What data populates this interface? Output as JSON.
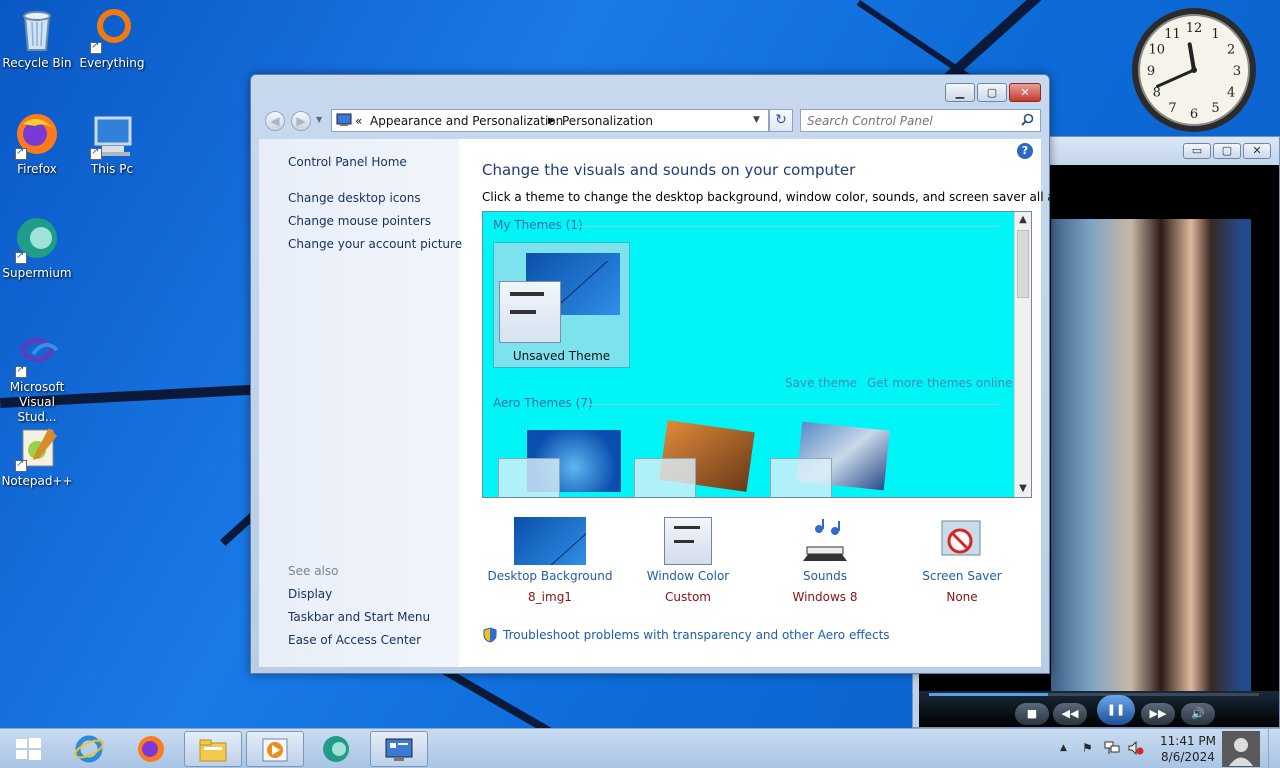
{
  "desktop": {
    "icons": [
      {
        "label": "Recycle Bin",
        "icon": "recycle-bin-icon"
      },
      {
        "label": "Everything",
        "icon": "everything-icon"
      },
      {
        "label": "Firefox",
        "icon": "firefox-icon"
      },
      {
        "label": "This Pc",
        "icon": "computer-icon"
      },
      {
        "label": "Supermium",
        "icon": "supermium-icon"
      },
      {
        "label": "Microsoft Visual Stud...",
        "icon": "visual-studio-icon"
      },
      {
        "label": "Notepad++",
        "icon": "notepad-plus-icon"
      }
    ]
  },
  "clock": {
    "time_shown": "11:41",
    "numerals": [
      "12",
      "1",
      "2",
      "3",
      "4",
      "5",
      "6",
      "7",
      "8",
      "9",
      "10",
      "11"
    ]
  },
  "window": {
    "address": {
      "crumb_root": "«",
      "crumb1": "Appearance and Personalization",
      "crumb2": "Personalization"
    },
    "search_placeholder": "Search Control Panel",
    "left_nav": {
      "home": "Control Panel Home",
      "links": [
        "Change desktop icons",
        "Change mouse pointers",
        "Change your account picture"
      ],
      "see_also_header": "See also",
      "see_also": [
        "Display",
        "Taskbar and Start Menu",
        "Ease of Access Center"
      ]
    },
    "main": {
      "title": "Change the visuals and sounds on your computer",
      "subtitle": "Click a theme to change the desktop background, window color, sounds, and screen saver all at once.",
      "my_themes_header": "My Themes (1)",
      "unsaved_theme_label": "Unsaved Theme",
      "save_theme_link": "Save theme",
      "get_more_link": "Get more themes online",
      "aero_themes_header": "Aero Themes (7)",
      "bottom_items": [
        {
          "name": "Desktop Background",
          "value": "8_img1",
          "icon": "desktop-background-icon"
        },
        {
          "name": "Window Color",
          "value": "Custom",
          "icon": "window-color-icon"
        },
        {
          "name": "Sounds",
          "value": "Windows 8",
          "icon": "sounds-icon"
        },
        {
          "name": "Screen Saver",
          "value": "None",
          "icon": "screen-saver-icon"
        }
      ],
      "troubleshoot_link": "Troubleshoot problems with transparency and other Aero effects"
    },
    "accent_theme_box": "#00f6f6"
  },
  "taskbar": {
    "clock_time": "11:41 PM",
    "clock_date": "8/6/2024",
    "pinned": [
      "start-button",
      "internet-explorer-icon",
      "firefox-icon",
      "file-explorer-icon",
      "media-player-icon",
      "supermium-icon",
      "control-panel-icon"
    ]
  }
}
